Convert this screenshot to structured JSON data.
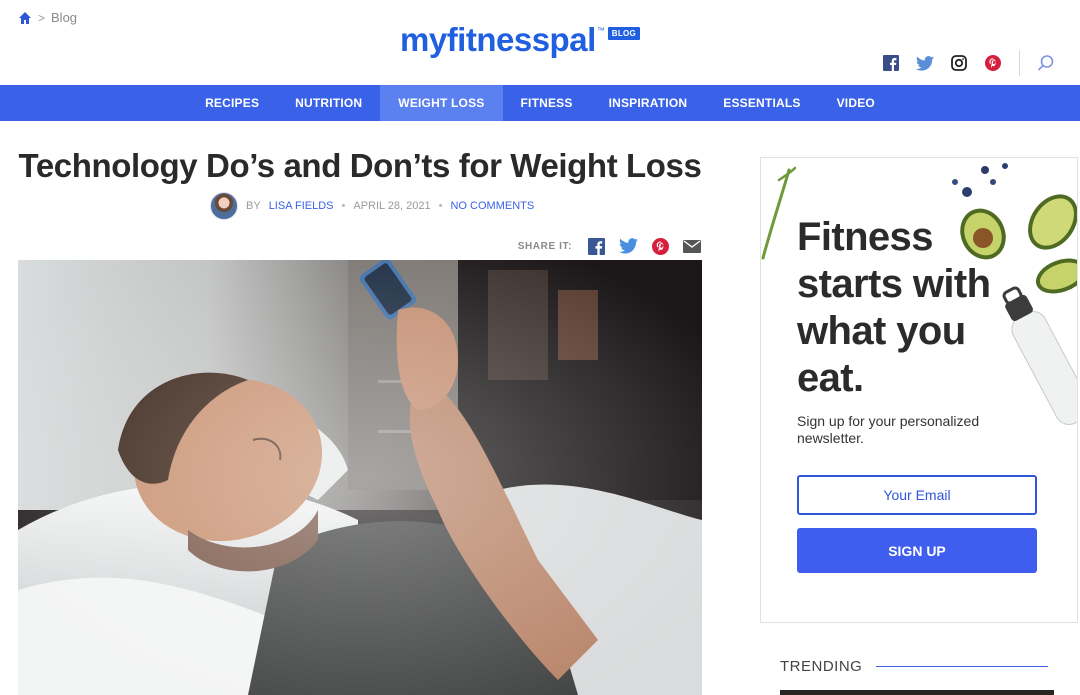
{
  "breadcrumb": {
    "home_icon": "home-icon",
    "separator": ">",
    "current": "Blog"
  },
  "logo": {
    "text": "myfitnesspal",
    "tm": "™",
    "badge": "BLOG"
  },
  "social": {
    "icons": [
      "facebook-icon",
      "twitter-icon",
      "instagram-icon",
      "pinterest-icon",
      "search-icon"
    ]
  },
  "nav": {
    "items": [
      {
        "label": "RECIPES"
      },
      {
        "label": "NUTRITION"
      },
      {
        "label": "WEIGHT LOSS",
        "active": true
      },
      {
        "label": "FITNESS"
      },
      {
        "label": "INSPIRATION"
      },
      {
        "label": "ESSENTIALS"
      },
      {
        "label": "VIDEO"
      }
    ]
  },
  "article": {
    "title": "Technology Do’s and Don’ts for Weight Loss",
    "by": "BY",
    "author": "LISA FIELDS",
    "dot": "•",
    "date": "APRIL 28, 2021",
    "comments": "NO COMMENTS",
    "share_label": "SHARE IT:"
  },
  "ad": {
    "headline": "Fitness starts with what you eat.",
    "sub": "Sign up for your personalized newsletter.",
    "email_placeholder": "Your Email",
    "signup_label": "SIGN UP"
  },
  "sidebar": {
    "trending_label": "TRENDING"
  },
  "colors": {
    "brand": "#1f5fe0",
    "nav_bg": "#3a62e8",
    "nav_active": "#5b80f0",
    "signup_bg": "#3f5ef0"
  }
}
